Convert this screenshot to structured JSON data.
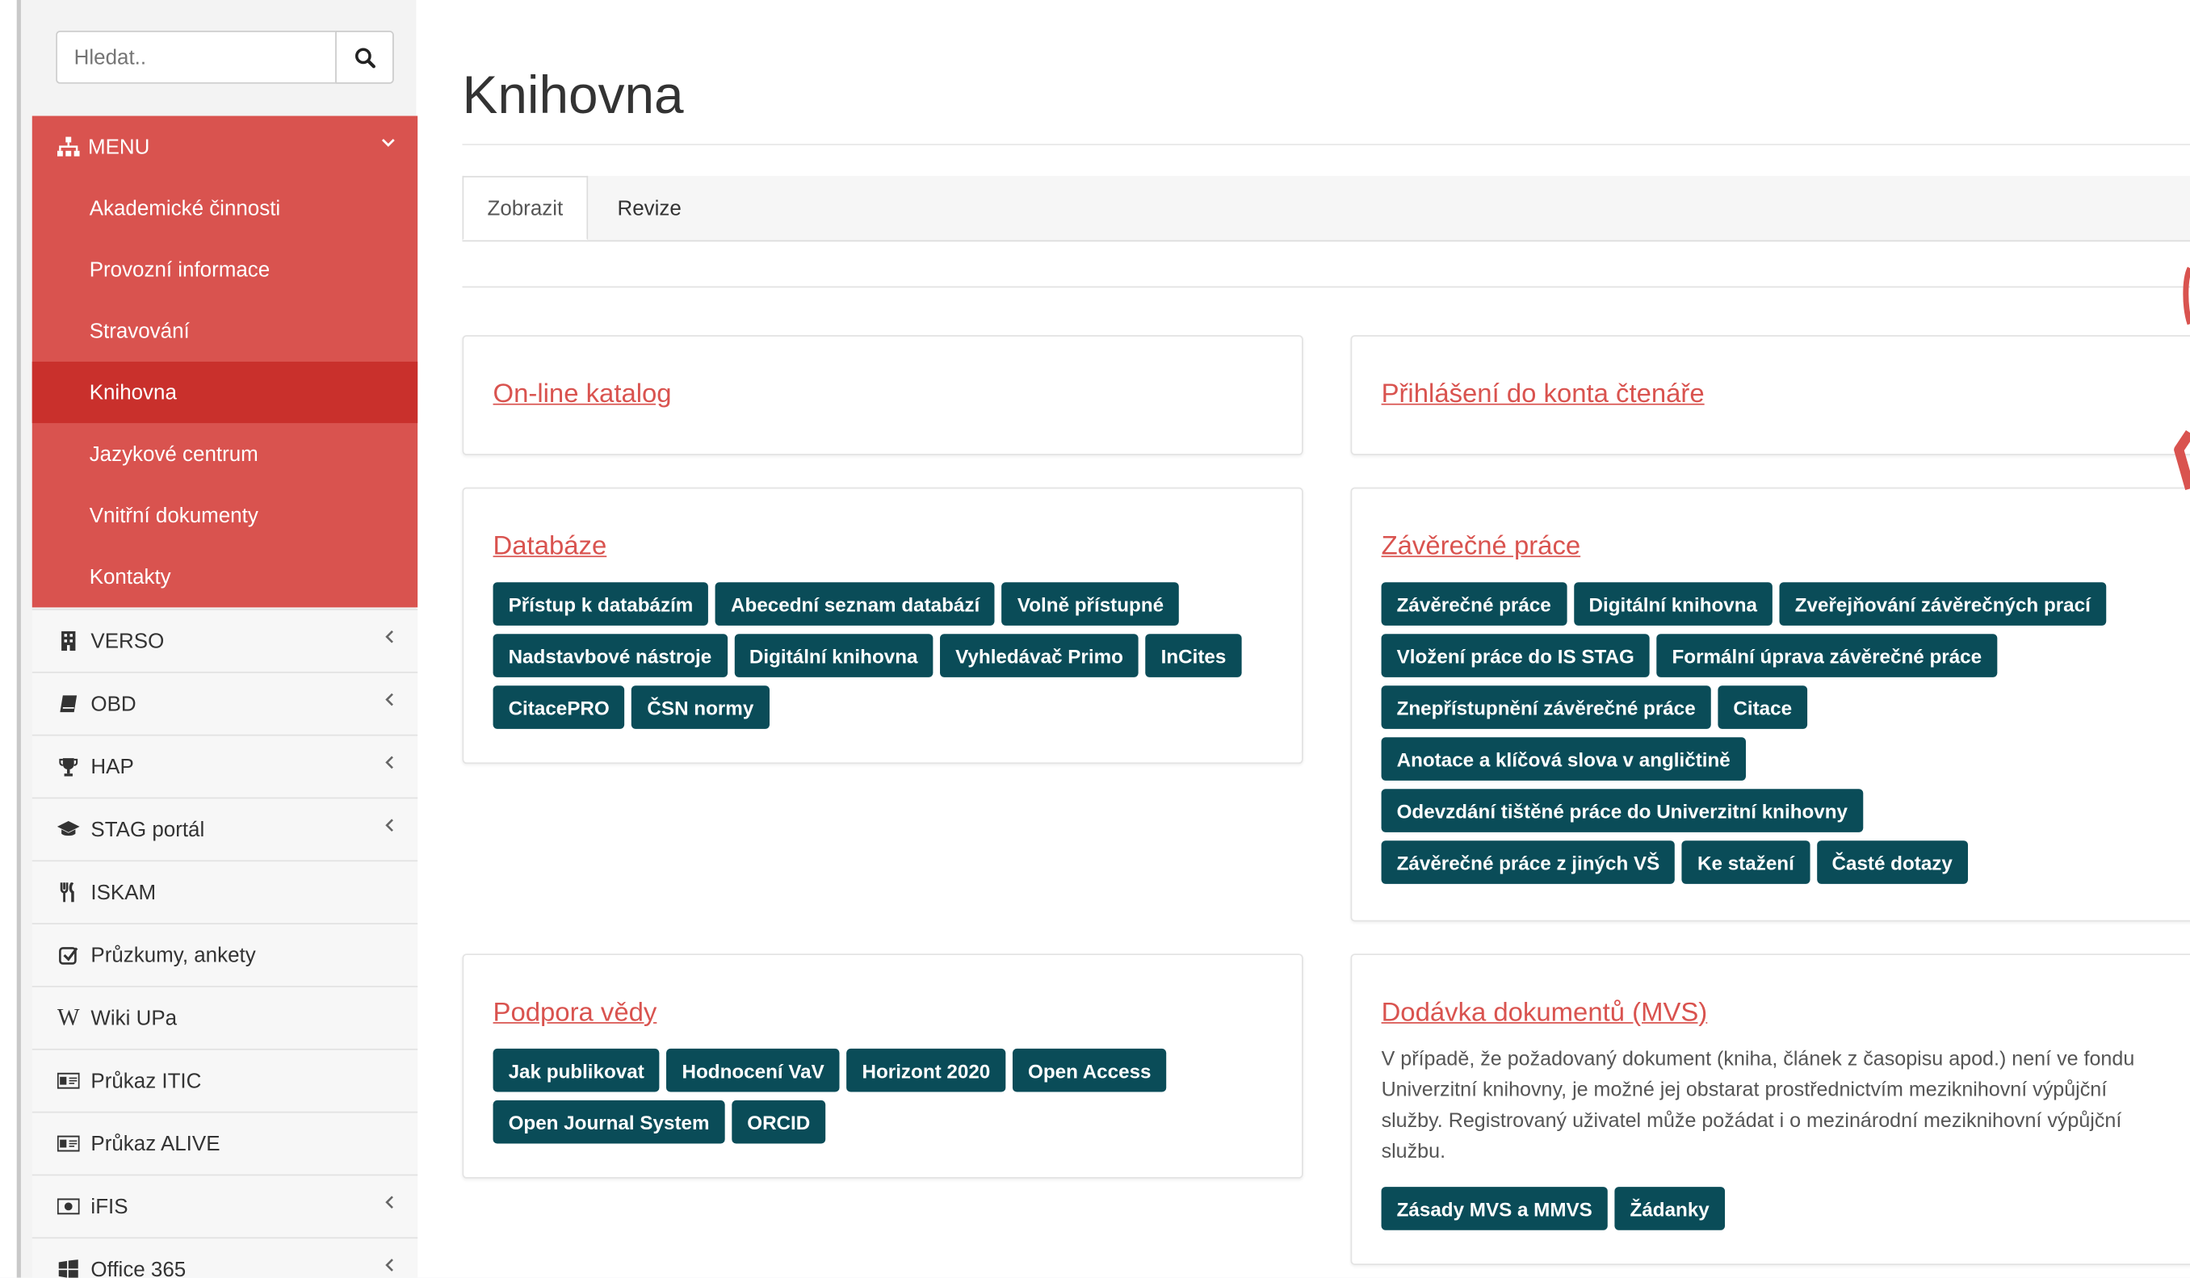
{
  "search": {
    "placeholder": "Hledat.."
  },
  "menu": {
    "title": "MENU",
    "items": [
      "Akademické činnosti",
      "Provozní informace",
      "Stravování",
      "Knihovna",
      "Jazykové centrum",
      "Vnitřní dokumenty",
      "Kontakty"
    ],
    "active": "Knihovna"
  },
  "nav": [
    {
      "label": "VERSO",
      "icon": "building-icon",
      "chevron": true
    },
    {
      "label": "OBD",
      "icon": "book-icon",
      "chevron": true
    },
    {
      "label": "HAP",
      "icon": "trophy-icon",
      "chevron": true
    },
    {
      "label": "STAG portál",
      "icon": "graduation-cap-icon",
      "chevron": true
    },
    {
      "label": "ISKAM",
      "icon": "cutlery-icon",
      "chevron": false
    },
    {
      "label": "Průzkumy, ankety",
      "icon": "checkbox-icon",
      "chevron": false
    },
    {
      "label": "Wiki UPa",
      "icon": "wikipedia-icon",
      "chevron": false
    },
    {
      "label": "Průkaz ITIC",
      "icon": "id-card-icon",
      "chevron": false
    },
    {
      "label": "Průkaz ALIVE",
      "icon": "id-card-icon",
      "chevron": false
    },
    {
      "label": "iFIS",
      "icon": "money-icon",
      "chevron": true
    },
    {
      "label": "Office 365",
      "icon": "windows-icon",
      "chevron": true
    }
  ],
  "page": {
    "title": "Knihovna"
  },
  "tabs": {
    "view": "Zobrazit",
    "revisions": "Revize"
  },
  "panels": {
    "catalog": {
      "title": "On-line katalog"
    },
    "reader_login": {
      "title": "Přihlášení do konta čtenáře"
    },
    "databases": {
      "title": "Databáze",
      "rows": [
        [
          "Přístup k databázím",
          "Abecední seznam databází",
          "Volně přístupné"
        ],
        [
          "Nadstavbové nástroje",
          "Digitální knihovna",
          "Vyhledávač Primo",
          "InCites"
        ],
        [
          "CitacePRO",
          "ČSN normy"
        ]
      ]
    },
    "theses": {
      "title": "Závěrečné práce",
      "rows": [
        [
          "Závěrečné práce",
          "Digitální knihovna",
          "Zveřejňování závěrečných prací"
        ],
        [
          "Vložení práce do IS STAG",
          "Formální úprava závěrečné práce"
        ],
        [
          "Znepřístupnění závěrečné práce",
          "Citace"
        ],
        [
          "Anotace a klíčová slova v angličtině"
        ],
        [
          "Odevzdání tištěné práce do Univerzitní knihovny"
        ],
        [
          "Závěrečné práce z jiných VŠ",
          "Ke stažení",
          "Časté dotazy"
        ]
      ]
    },
    "research": {
      "title": "Podpora vědy",
      "rows": [
        [
          "Jak publikovat",
          "Hodnocení VaV",
          "Horizont 2020",
          "Open Access"
        ],
        [
          "Open Journal System",
          "ORCID"
        ]
      ]
    },
    "delivery": {
      "title": "Dodávka dokumentů (MVS)",
      "text": "V případě, že požadovaný dokument (kniha, článek z časopisu apod.) není ve fondu Univerzitní knihovny, je možné jej obstarat prostřednictvím meziknihovní výpůjční služby. Registrovaný uživatel může požádat i o mezinárodní meziknihovní výpůjční službu.",
      "rows": [
        [
          "Zásady MVS a MMVS",
          "Žádanky"
        ]
      ]
    }
  },
  "colors": {
    "accent": "#d9534f",
    "accent_active": "#c9302c",
    "button": "#0a4c58"
  }
}
